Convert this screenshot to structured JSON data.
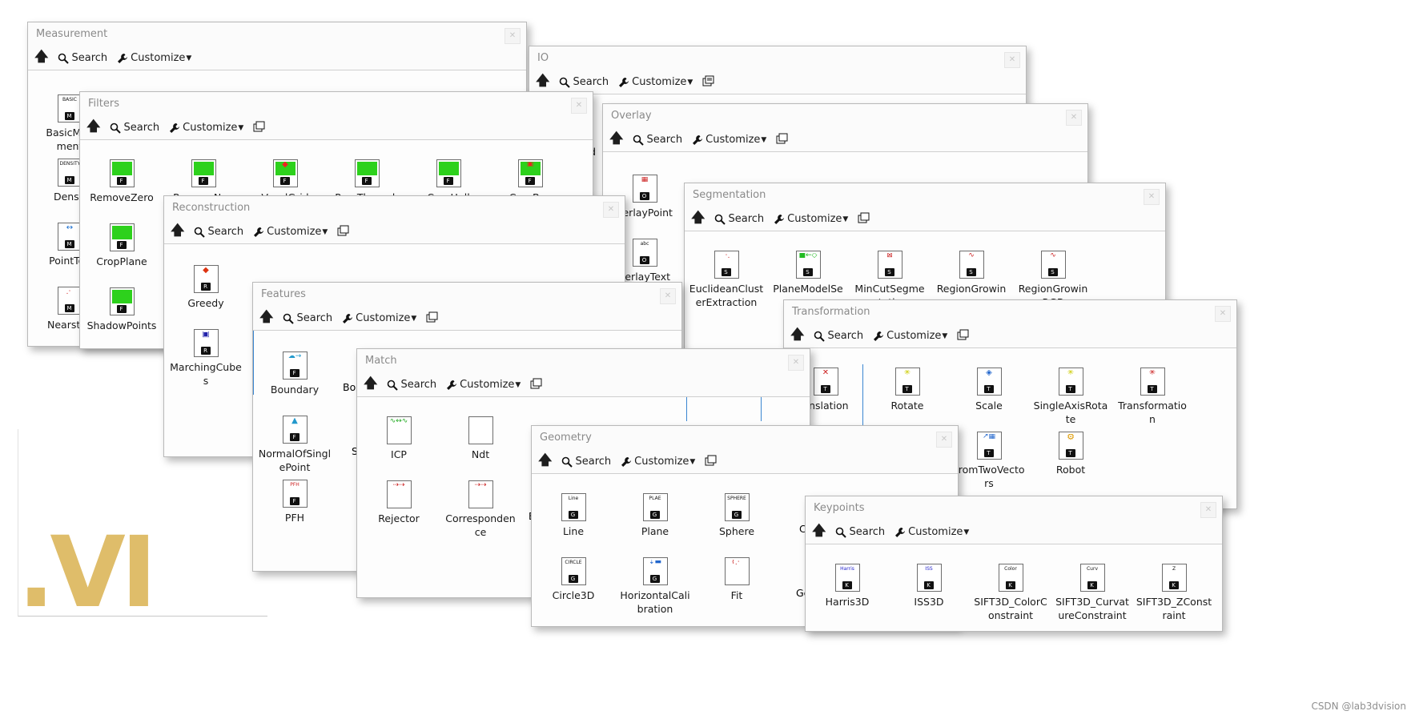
{
  "toolbar": {
    "search": "Search",
    "customize": "Customize"
  },
  "logo_text": ".VI",
  "watermark": "CSDN @lab3dvision",
  "palettes": {
    "measurement": {
      "title": "Measurement",
      "items": [
        "BasicMeasurement",
        "Density",
        "PointToPoint",
        "NearstPoint"
      ]
    },
    "io": {
      "title": "IO",
      "items": [
        "...d"
      ]
    },
    "filters": {
      "title": "Filters",
      "items": [
        "RemoveZero",
        "RemoveNan",
        "VoxelGrid",
        "PassThrough",
        "CropHull",
        "CropBox",
        "CropPlane",
        "ShadowPoints"
      ]
    },
    "overlay": {
      "title": "Overlay",
      "items": [
        "OverlayPoint",
        "OverlayText"
      ]
    },
    "segmentation": {
      "title": "Segmentation",
      "items": [
        "EuclideanClusterExtraction",
        "PlaneModelSegmentation",
        "MinCutSegmentation",
        "RegionGrowing",
        "RegionGrowingRGB"
      ]
    },
    "reconstruction": {
      "title": "Reconstruction",
      "items": [
        "Greedy",
        "MarchingCubes"
      ]
    },
    "features": {
      "title": "Features",
      "items": [
        "Boundary",
        "Bo...",
        "NormalOfSinglePoint",
        "S...",
        "PFH"
      ]
    },
    "transformation": {
      "title": "Transformation",
      "items": [
        "Translation",
        "Rotate",
        "Scale",
        "SingleAxisRotate",
        "Transformation",
        "FromTwoVectors",
        "Robot"
      ]
    },
    "match": {
      "title": "Match",
      "items": [
        "ICP",
        "Ndt",
        "Rejector",
        "Correspondence",
        "E..."
      ]
    },
    "geometry": {
      "title": "Geometry",
      "items": [
        "Line",
        "Plane",
        "Sphere",
        "C...",
        "Circle3D",
        "HorizontalCalibration",
        "Fit",
        "Ge..."
      ]
    },
    "keypoints": {
      "title": "Keypoints",
      "items": [
        "Harris3D",
        "ISS3D",
        "SIFT3D_ColorConstraint",
        "SIFT3D_CurvatureConstraint",
        "SIFT3D_ZConstraint"
      ]
    }
  },
  "labels": {
    "m1": "BasicMea\nment",
    "m2": "Densit",
    "m3": "PointToP",
    "m4": "NearstPo",
    "io1": "d",
    "f1": "RemoveZero",
    "f2": "RemoveNan",
    "f3": "VoxelGrid",
    "f4": "PassThrough",
    "f5": "CropHull",
    "f6": "CropBox",
    "f7": "CropPlane",
    "f8": "ShadowPoints",
    "o1": "verlayPoint",
    "o2": "verlayText",
    "s1": "EuclideanClust\nerExtraction",
    "s2": "PlaneModelSe\ng...",
    "s3": "MinCutSegme\nntation",
    "s4": "RegionGrowin",
    "s5": "RegionGrowin\nRGB",
    "r1": "Greedy",
    "r2": "MarchingCube\ns",
    "fe1": "Boundary",
    "fe2": "Bou",
    "fe3": "NormalOfSingl\nePoint",
    "fe4": "S",
    "fe5": "PFH",
    "t1": "anslation",
    "t2": "Rotate",
    "t3": "Scale",
    "t4": "SingleAxisRota\nte",
    "t5": "Transformatio\nn",
    "t6": "FromTwoVecto\nrs",
    "t7": "Robot",
    "ma1": "ICP",
    "ma2": "Ndt",
    "ma3": "Rejector",
    "ma4": "Corresponden\nce",
    "ma5": "E",
    "g1": "Line",
    "g2": "Plane",
    "g3": "Sphere",
    "g4": "C",
    "g5": "Circle3D",
    "g6": "HorizontalCali\nbration",
    "g7": "Fit",
    "g8": "Ge",
    "k1": "Harris3D",
    "k2": "ISS3D",
    "k3": "SIFT3D_ColorC\nonstraint",
    "k4": "SIFT3D_Curvat\nureConstraint",
    "k5": "SIFT3D_ZConst\nraint"
  },
  "icon_text": {
    "basic": "BASIC",
    "density": "DENSITY",
    "line": "Line",
    "plane": "PLAE",
    "sphere": "SPHERE",
    "circle": "CIRCLE",
    "harris": "Harris",
    "iss": "ISS",
    "color": "Color",
    "curv": "Curv",
    "pfh": "PFH",
    "abc": "abc",
    "z": "Z"
  },
  "badges": {
    "M": "M",
    "F": "F",
    "S": "S",
    "R": "R",
    "T": "T",
    "K": "K",
    "O": "O",
    "G": "G"
  },
  "colors": {
    "accent": "#3a86d1",
    "logo": "#dfbd6a",
    "green": "#2dd11c"
  }
}
